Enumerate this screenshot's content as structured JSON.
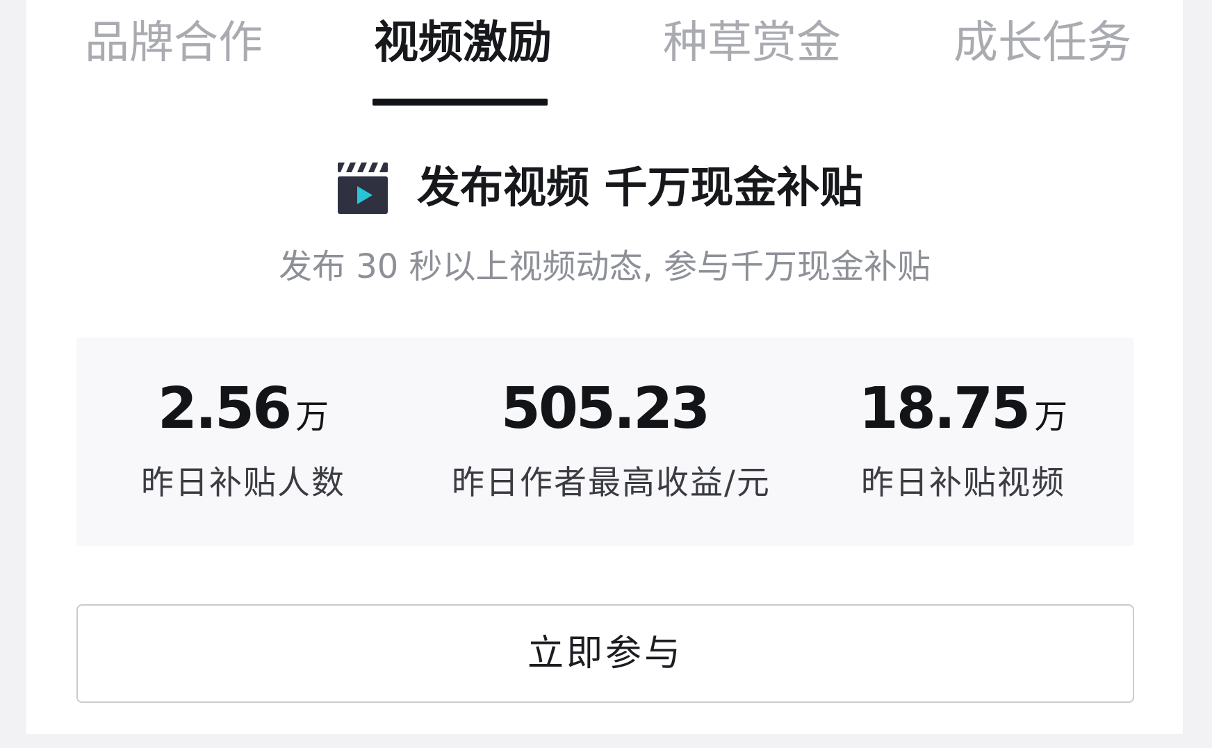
{
  "tabs": [
    {
      "label": "品牌合作",
      "active": false
    },
    {
      "label": "视频激励",
      "active": true
    },
    {
      "label": "种草赏金",
      "active": false
    },
    {
      "label": "成长任务",
      "active": false
    }
  ],
  "headline": {
    "icon": "clapperboard-icon",
    "title": "发布视频 千万现金补贴"
  },
  "subtitle": "发布 30 秒以上视频动态, 参与千万现金补贴",
  "stats": [
    {
      "value": "2.56",
      "unit": "万",
      "label": "昨日补贴人数"
    },
    {
      "value": "505.23",
      "unit": "",
      "label": "昨日作者最高收益/元"
    },
    {
      "value": "18.75",
      "unit": "万",
      "label": "昨日补贴视频"
    }
  ],
  "cta": {
    "label": "立即参与"
  },
  "colors": {
    "active_tab": "#17181c",
    "inactive_tab": "#a9abb1",
    "clapper_accent": "#29c4d6",
    "clapper_body": "#2f3140"
  }
}
